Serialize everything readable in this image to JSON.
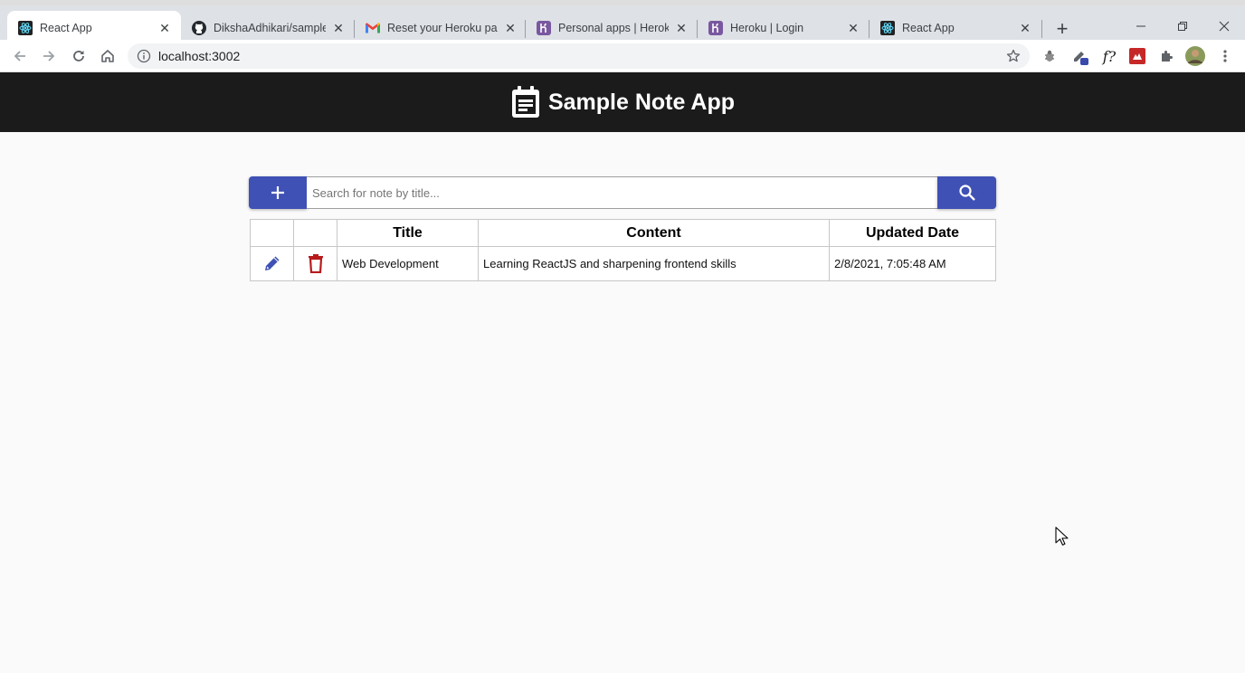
{
  "browser": {
    "tabs": [
      {
        "title": "React App",
        "active": true,
        "icon": "react-icon"
      },
      {
        "title": "DikshaAdhikari/sample-",
        "active": false,
        "icon": "github-icon"
      },
      {
        "title": "Reset your Heroku pas:",
        "active": false,
        "icon": "gmail-icon"
      },
      {
        "title": "Personal apps | Heroku",
        "active": false,
        "icon": "heroku-icon"
      },
      {
        "title": "Heroku | Login",
        "active": false,
        "icon": "heroku-icon"
      },
      {
        "title": "React App",
        "active": false,
        "icon": "react-icon"
      }
    ],
    "url": "localhost:3002",
    "colors": {
      "tabstrip": "#dee1e6",
      "toolbar": "#ffffff"
    }
  },
  "app": {
    "title": "Sample Note App",
    "search": {
      "placeholder": "Search for note by title...",
      "value": ""
    },
    "table": {
      "columns": [
        "",
        "",
        "Title",
        "Content",
        "Updated Date"
      ],
      "rows": [
        {
          "title": "Web Development",
          "content": "Learning ReactJS and sharpening frontend skills",
          "updated": "2/8/2021, 7:05:48 AM"
        }
      ]
    },
    "colors": {
      "header_bg": "#1b1b1b",
      "primary": "#3f51b5",
      "edit_icon": "#3f51b5",
      "delete_icon": "#b71c1c"
    }
  }
}
